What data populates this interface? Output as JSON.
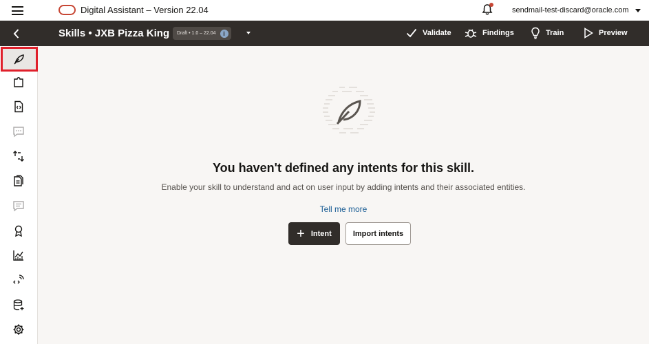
{
  "appbar": {
    "title": "Digital Assistant – Version 22.04",
    "user_email": "sendmail-test-discard@oracle.com",
    "icons": [
      "menu-icon",
      "oracle-logo",
      "bell-icon",
      "chevron-down-icon"
    ]
  },
  "header": {
    "skill_title": "Skills • JXB Pizza King",
    "version_badge": "Draft • 1.0 – 22.04",
    "info_glyph": "i",
    "actions": {
      "validate": "Validate",
      "findings": "Findings",
      "train": "Train",
      "preview": "Preview"
    }
  },
  "rail": {
    "items": [
      {
        "icon": "intents-feather-icon",
        "selected": true
      },
      {
        "icon": "entities-puzzle-icon"
      },
      {
        "icon": "flows-code-doc-icon"
      },
      {
        "icon": "resource-bundles-chat-icon",
        "disabled": true
      },
      {
        "icon": "translation-swap-icon"
      },
      {
        "icon": "documents-icon"
      },
      {
        "icon": "conversations-chat-icon",
        "disabled": true
      },
      {
        "icon": "quality-badge-icon"
      },
      {
        "icon": "insights-chart-icon"
      },
      {
        "icon": "channels-wifi-code-icon"
      },
      {
        "icon": "data-database-icon"
      },
      {
        "icon": "settings-gear-icon"
      }
    ]
  },
  "empty_state": {
    "heading": "You haven't defined any intents for this skill.",
    "description": "Enable your skill to understand and act on user input by adding intents and their associated entities.",
    "link": "Tell me more",
    "primary_button": "Intent",
    "secondary_button": "Import intents"
  },
  "colors": {
    "accent_dark": "#312d2a",
    "oracle_red": "#c74634",
    "selection_outline": "#e0202b",
    "link": "#1a5d95",
    "background": "#f8f6f4"
  }
}
